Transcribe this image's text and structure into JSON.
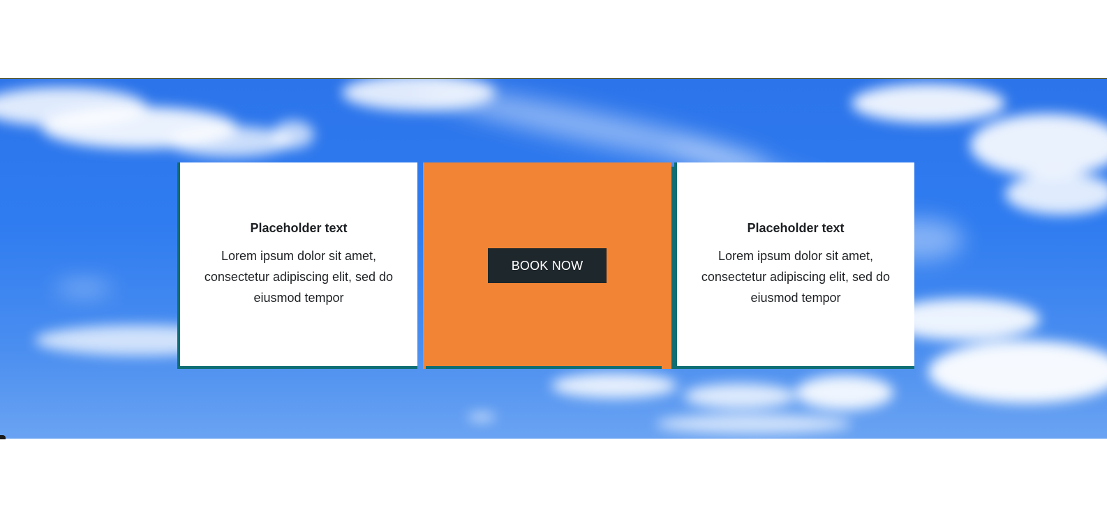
{
  "colors": {
    "card_accent": "#0e6e74",
    "cta_background": "#f28535",
    "button_background": "#1e272b",
    "sky": "#2f7cf0"
  },
  "hero": {
    "background": "sky-with-clouds-image"
  },
  "cards": [
    {
      "title": "Placeholder text",
      "body": "Lorem ipsum dolor sit amet, consectetur adipiscing elit, sed do eiusmod tempor"
    },
    {
      "button_label": "BOOK NOW"
    },
    {
      "title": "Placeholder text",
      "body": "Lorem ipsum dolor sit amet, consectetur adipiscing elit, sed do eiusmod tempor"
    }
  ]
}
